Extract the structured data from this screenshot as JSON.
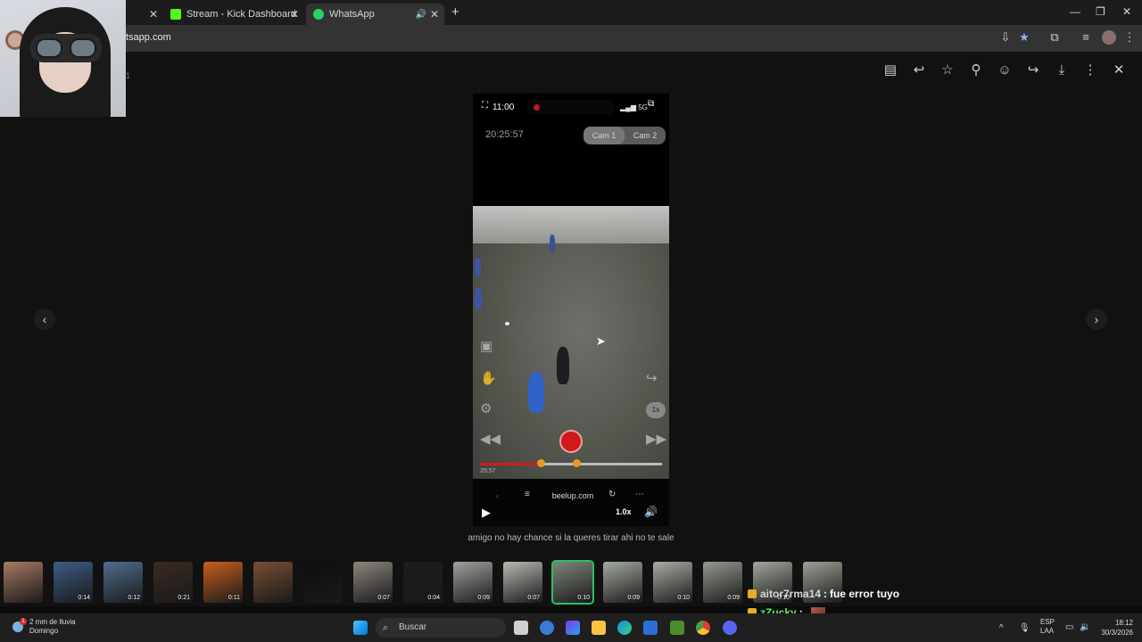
{
  "browser": {
    "tabs": [
      {
        "label": "",
        "active": false
      },
      {
        "label": "Stream - Kick Dashboard",
        "active": false
      },
      {
        "label": "WhatsApp",
        "active": true
      }
    ],
    "url": "tsapp.com",
    "new_tab": "+"
  },
  "viewer": {
    "side_label": "1",
    "toolbar_icons": [
      "caption-icon",
      "reply-icon",
      "star-icon",
      "pin-icon",
      "emoji-icon",
      "forward-icon",
      "download-icon",
      "more-icon",
      "close-icon"
    ],
    "prev": "‹",
    "next": "›",
    "caption": "amigo no hay chance si la queres tirar ahi no te sale"
  },
  "video": {
    "status_time": "11:00",
    "status_net": "5G",
    "clock": "20:25:57",
    "cam1": "Cam 1",
    "cam2": "Cam 2",
    "speed_chip": "1x",
    "seek_fraction": 0.32,
    "timestamp_left": "25:57",
    "source": "beelup.com",
    "speed": "1.0x"
  },
  "thumbnails": [
    {
      "dur": "",
      "color": "#a87a63"
    },
    {
      "dur": "0:14",
      "color": "#3d5c86"
    },
    {
      "dur": "0:12",
      "color": "#4f6f8f"
    },
    {
      "dur": "0:21",
      "color": "#3a2a22"
    },
    {
      "dur": "0:11",
      "color": "#c85f1e"
    },
    {
      "dur": "",
      "color": "#7a4e33"
    },
    {
      "dur": "",
      "color": "#0d0d0d"
    },
    {
      "dur": "0:07",
      "color": "#8c857d"
    },
    {
      "dur": "0:04",
      "color": "#1c1c20"
    },
    {
      "dur": "0:09",
      "color": "#9fa39d"
    },
    {
      "dur": "0:07",
      "color": "#b7bab2"
    },
    {
      "dur": "0:10",
      "color": "#7f857c",
      "selected": true
    },
    {
      "dur": "0:09",
      "color": "#a5aaa2"
    },
    {
      "dur": "0:10",
      "color": "#a9ada4"
    },
    {
      "dur": "0:09",
      "color": "#949a8f"
    },
    {
      "dur": "0:10",
      "color": "#a3a79c"
    },
    {
      "dur": "",
      "color": "#9da195"
    }
  ],
  "chat": [
    {
      "user": "aitor7rma14",
      "sep": ":",
      "message": "fue error tuyo",
      "emote": false,
      "user_color": "#d8d8d8"
    },
    {
      "user": "zZucky",
      "sep": ":",
      "message": "",
      "emote": true,
      "user_color": "#5ef05e"
    },
    {
      "user": "aitor7rma14",
      "sep": ":",
      "message": "",
      "emote": true,
      "user_color": "#d8d8d8"
    }
  ],
  "taskbar": {
    "weather_line1": "2 mm de lluvia",
    "weather_line2": "Domingo",
    "weather_badge": "1",
    "search_placeholder": "Buscar",
    "lang1": "ESP",
    "lang2": "LAA",
    "time": "18:12",
    "date": "30/3/2026"
  }
}
